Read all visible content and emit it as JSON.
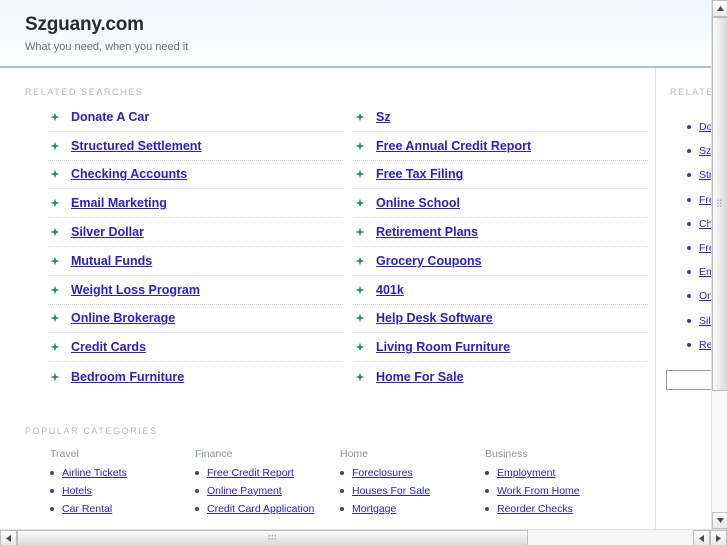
{
  "header": {
    "title": "Szguany.com",
    "tagline": "What you need, when you need it"
  },
  "main": {
    "related_label": "RELATED SEARCHES",
    "related_left": [
      {
        "label": "Donate A Car",
        "underlined": false
      },
      {
        "label": "Structured Settlement",
        "underlined": true
      },
      {
        "label": "Checking Accounts",
        "underlined": true
      },
      {
        "label": "Email Marketing",
        "underlined": true
      },
      {
        "label": "Silver Dollar",
        "underlined": true
      },
      {
        "label": "Mutual Funds",
        "underlined": true
      },
      {
        "label": "Weight Loss Program",
        "underlined": true
      },
      {
        "label": "Online Brokerage",
        "underlined": true
      },
      {
        "label": "Credit Cards",
        "underlined": true
      },
      {
        "label": "Bedroom Furniture",
        "underlined": true
      }
    ],
    "related_right": [
      {
        "label": "Sz",
        "underlined": true
      },
      {
        "label": "Free Annual Credit Report",
        "underlined": true
      },
      {
        "label": "Free Tax Filing",
        "underlined": true
      },
      {
        "label": "Online School",
        "underlined": true
      },
      {
        "label": "Retirement Plans",
        "underlined": true
      },
      {
        "label": "Grocery Coupons",
        "underlined": true
      },
      {
        "label": "401k",
        "underlined": true
      },
      {
        "label": "Help Desk Software",
        "underlined": true
      },
      {
        "label": "Living Room Furniture",
        "underlined": true
      },
      {
        "label": "Home For Sale",
        "underlined": true
      }
    ],
    "categories_label": "POPULAR CATEGORIES",
    "categories": [
      {
        "title": "Travel",
        "items": [
          "Airline Tickets",
          "Hotels",
          "Car Rental"
        ]
      },
      {
        "title": "Finance",
        "items": [
          "Free Credit Report",
          "Online Payment",
          "Credit Card Application"
        ]
      },
      {
        "title": "Home",
        "items": [
          "Foreclosures",
          "Houses For Sale",
          "Mortgage"
        ]
      },
      {
        "title": "Business",
        "items": [
          "Employment",
          "Work From Home",
          "Reorder Checks"
        ]
      }
    ]
  },
  "sidebar": {
    "label": "RELATED",
    "items": [
      "Donate A Car",
      "Sz",
      "Structured Settlement",
      "Free Annual Credit Report",
      "Checking Accounts",
      "Free Tax Filing",
      "Email Marketing",
      "Online School",
      "Silver Dollar",
      "Retirement Plans"
    ],
    "search_value": "",
    "search_placeholder": ""
  },
  "colors": {
    "link": "#2b21c4",
    "arrow": "#2e8b57",
    "header_border": "#aebfd9",
    "label": "#b4b9bf"
  }
}
